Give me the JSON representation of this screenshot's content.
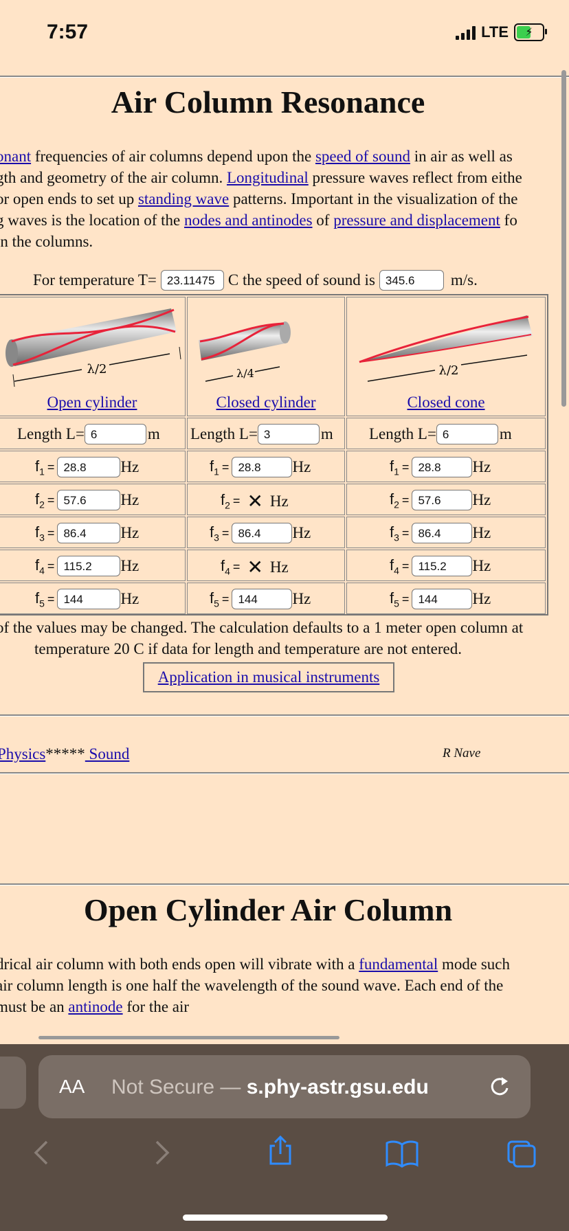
{
  "status": {
    "time": "7:57",
    "network": "LTE"
  },
  "page": {
    "title": "Air Column Resonance",
    "intro": {
      "l1": [
        "onant",
        " frequencies of air columns depend upon the ",
        "speed of sound",
        " in air as well as"
      ],
      "l2": [
        "gth and geometry of the air column. ",
        "Longitudinal",
        " pressure waves reflect from eithe"
      ],
      "l3": [
        "or open ends to set up ",
        "standing wave",
        " patterns. Important in the visualization of the"
      ],
      "l4": [
        "g waves is the location of the ",
        "nodes and antinodes",
        " of ",
        "pressure and displacement",
        " fo"
      ],
      "l5": "in the columns."
    },
    "temp_row": {
      "prefix": "For temperature T=",
      "temp_value": "23.11475",
      "middle": "C the speed of sound is",
      "speed_value": "345.6",
      "unit": "m/s."
    },
    "columns": [
      {
        "diagram_label": "λ/2",
        "caption": "Open cylinder",
        "length_label": "Length L=",
        "length_value": "6",
        "length_unit": "m",
        "freqs": [
          {
            "sym": "f",
            "sub": "1",
            "value": "28.8",
            "unit": "Hz"
          },
          {
            "sym": "f",
            "sub": "2",
            "value": "57.6",
            "unit": "Hz"
          },
          {
            "sym": "f",
            "sub": "3",
            "value": "86.4",
            "unit": "Hz"
          },
          {
            "sym": "f",
            "sub": "4",
            "value": "115.2",
            "unit": "Hz"
          },
          {
            "sym": "f",
            "sub": "5",
            "value": "144",
            "unit": "Hz"
          }
        ]
      },
      {
        "diagram_label": "λ/4",
        "caption": "Closed cylinder",
        "length_label": "Length L=",
        "length_value": "3",
        "length_unit": "m",
        "freqs": [
          {
            "sym": "f",
            "sub": "1",
            "value": "28.8",
            "unit": "Hz"
          },
          {
            "sym": "f",
            "sub": "2",
            "value": "✕",
            "unit": "Hz"
          },
          {
            "sym": "f",
            "sub": "3",
            "value": "86.4",
            "unit": "Hz"
          },
          {
            "sym": "f",
            "sub": "4",
            "value": "✕",
            "unit": "Hz"
          },
          {
            "sym": "f",
            "sub": "5",
            "value": "144",
            "unit": "Hz"
          }
        ]
      },
      {
        "diagram_label": "λ/2",
        "caption": "Closed cone",
        "length_label": "Length L=",
        "length_value": "6",
        "length_unit": "m",
        "freqs": [
          {
            "sym": "f",
            "sub": "1",
            "value": "28.8",
            "unit": "Hz"
          },
          {
            "sym": "f",
            "sub": "2",
            "value": "57.6",
            "unit": "Hz"
          },
          {
            "sym": "f",
            "sub": "3",
            "value": "86.4",
            "unit": "Hz"
          },
          {
            "sym": "f",
            "sub": "4",
            "value": "115.2",
            "unit": "Hz"
          },
          {
            "sym": "f",
            "sub": "5",
            "value": "144",
            "unit": "Hz"
          }
        ]
      }
    ],
    "note_l1": "of the values may be changed. The calculation defaults to a 1 meter open column at",
    "note_l2": "temperature 20 C if data for length and temperature are not entered.",
    "app_link": "Application in musical instruments",
    "footer": {
      "physics": "Physics",
      "stars": "*****",
      "sound": " Sound",
      "author": "R Nave"
    },
    "section2": {
      "title": "Open Cylinder Air Column",
      "l1": [
        "drical air column with both ends open will vibrate with a ",
        "fundamental",
        " mode such"
      ],
      "l2": " air column length is one half the wavelength of the sound wave. Each end of the",
      "l3": [
        "must be an ",
        "antinode",
        " for the air"
      ]
    }
  },
  "browser": {
    "aa": "AA",
    "url_prefix": "Not Secure — ",
    "url_host": "s.phy-astr.gsu.edu"
  }
}
